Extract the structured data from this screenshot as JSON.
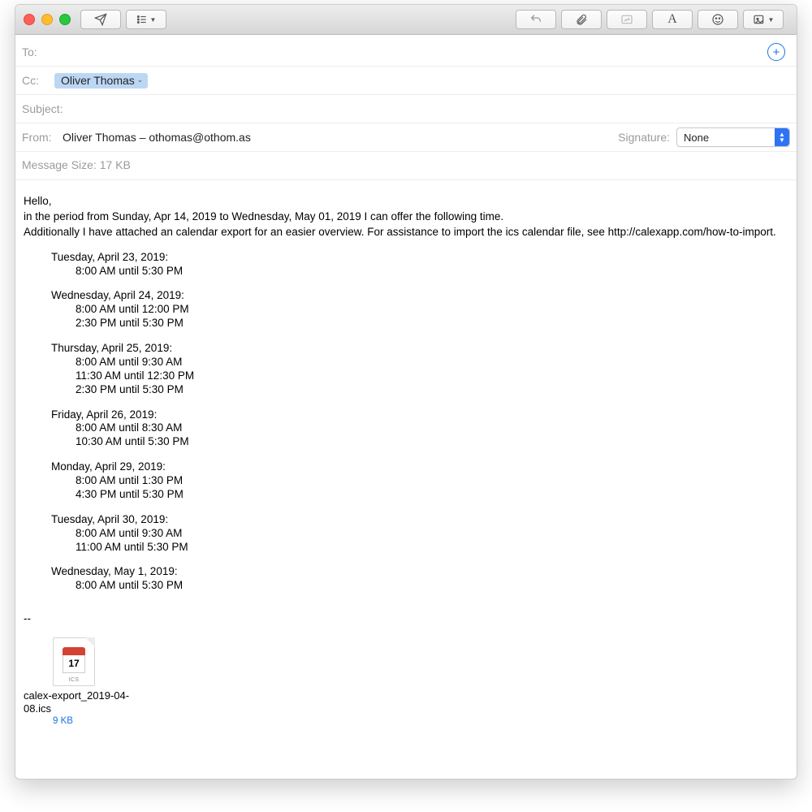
{
  "toolbar": {
    "send_title": "Send",
    "header_menu_title": "Header options",
    "reply_title": "Reply",
    "attach_title": "Attach",
    "markup_title": "Markup",
    "font_title": "Format",
    "emoji_title": "Emoji & Symbols",
    "photo_title": "Photo Browser"
  },
  "fields": {
    "to_label": "To:",
    "to_value": "",
    "cc_label": "Cc:",
    "cc_chip": "Oliver Thomas",
    "subject_label": "Subject:",
    "subject_value": "",
    "from_label": "From:",
    "from_value": "Oliver Thomas – othomas@othom.as",
    "signature_label": "Signature:",
    "signature_value": "None",
    "msg_size": "Message Size: 17 KB"
  },
  "body": {
    "greeting": "Hello,",
    "line1": "in the period from Sunday, Apr 14, 2019 to Wednesday, May 01, 2019 I can offer the following time.",
    "line2": "Additionally I have attached an calendar export for an easier overview. For assistance to import the ics calendar file, see http://calexapp.com/how-to-import.",
    "days": [
      {
        "title": "Tuesday, April 23, 2019:",
        "slots": [
          "8:00 AM until 5:30 PM"
        ]
      },
      {
        "title": "Wednesday, April 24, 2019:",
        "slots": [
          "8:00 AM until 12:00 PM",
          "2:30 PM until 5:30 PM"
        ]
      },
      {
        "title": "Thursday, April 25, 2019:",
        "slots": [
          "8:00 AM until 9:30 AM",
          "11:30 AM until 12:30 PM",
          "2:30 PM until 5:30 PM"
        ]
      },
      {
        "title": "Friday, April 26, 2019:",
        "slots": [
          "8:00 AM until 8:30 AM",
          "10:30 AM until 5:30 PM"
        ]
      },
      {
        "title": "Monday, April 29, 2019:",
        "slots": [
          "8:00 AM until 1:30 PM",
          "4:30 PM until 5:30 PM"
        ]
      },
      {
        "title": "Tuesday, April 30, 2019:",
        "slots": [
          "8:00 AM until 9:30 AM",
          "11:00 AM until 5:30 PM"
        ]
      },
      {
        "title": "Wednesday, May 1, 2019:",
        "slots": [
          "8:00 AM until 5:30 PM"
        ]
      }
    ],
    "signature_sep": "--"
  },
  "attachment": {
    "icon_day": "17",
    "icon_ext": "ICS",
    "filename": "calex-export_2019-04-08.ics",
    "size": "9 KB"
  }
}
